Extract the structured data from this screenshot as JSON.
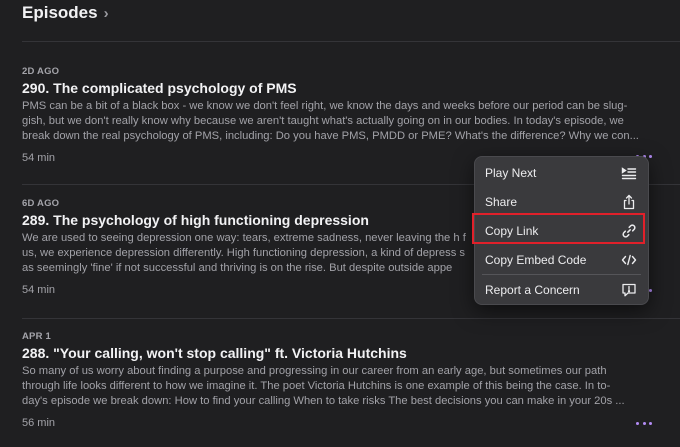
{
  "header": {
    "title": "Episodes",
    "chevron_icon": "chevron-right-icon"
  },
  "episodes": [
    {
      "date": "2D AGO",
      "title": "290. The complicated psychology of PMS",
      "description": "PMS can be a bit of a black box - we know we don't feel right, we know the days and weeks before our period can be slug-\ngish, but we don't really know why because we aren't taught what's actually going on in our bodies. In today's episode, we\nbreak down the real psychology of PMS, including:  Do you have PMS, PMDD or PME? What's the difference? Why we con...",
      "duration": "54 min"
    },
    {
      "date": "6D AGO",
      "title": "289. The psychology of high functioning depression",
      "description": "We are used to seeing depression one way: tears, extreme sadness, never leaving the h                                                          f\nus, we experience depression differently. High functioning depression, a kind of depress                                                s\nas seemingly 'fine' if not successful and thriving is on the rise. But despite outside appe",
      "duration": "54 min"
    },
    {
      "date": "APR 1",
      "title": "288. \"Your calling, won't stop calling\" ft. Victoria Hutchins",
      "description": "So many of us worry about finding a purpose and progressing in our career from an early age, but sometimes our path\nthrough life looks different to how we imagine it. The poet Victoria Hutchins is one example of this being the case. In to-\nday's episode we break down:  How to find your calling When to take risks  The best decisions you can make in your 20s ...",
      "duration": "56 min"
    }
  ],
  "context_menu": {
    "items": [
      {
        "label": "Play Next",
        "icon": "play-next-icon"
      },
      {
        "label": "Share",
        "icon": "share-icon"
      },
      {
        "label": "Copy Link",
        "icon": "link-icon"
      },
      {
        "label": "Copy Embed Code",
        "icon": "code-icon"
      },
      {
        "label": "Report a Concern",
        "icon": "report-icon"
      }
    ]
  },
  "colors": {
    "accent": "#b38cf5",
    "background": "#1f1f21",
    "highlight": "#e0202a"
  }
}
